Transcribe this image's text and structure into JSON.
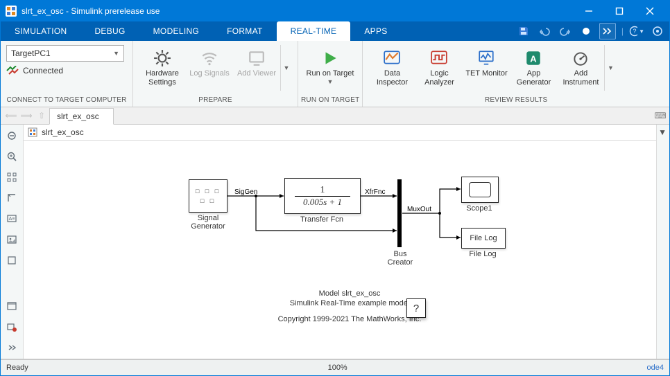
{
  "window": {
    "title": "slrt_ex_osc - Simulink prerelease use"
  },
  "tabs": {
    "items": [
      "SIMULATION",
      "DEBUG",
      "MODELING",
      "FORMAT",
      "REAL-TIME",
      "APPS"
    ],
    "active_index": 4
  },
  "toolstrip": {
    "connect": {
      "label": "CONNECT TO TARGET COMPUTER",
      "target_selected": "TargetPC1",
      "status": "Connected"
    },
    "prepare": {
      "label": "PREPARE",
      "hardware": "Hardware\nSettings",
      "log": "Log\nSignals",
      "viewer": "Add\nViewer"
    },
    "run": {
      "label": "RUN ON TARGET",
      "button": "Run on\nTarget"
    },
    "review": {
      "label": "REVIEW RESULTS",
      "di": "Data\nInspector",
      "la": "Logic\nAnalyzer",
      "tet": "TET\nMonitor",
      "appgen": "App\nGenerator",
      "addinstr": "Add\nInstrument"
    }
  },
  "model_tabs": {
    "name": "slrt_ex_osc"
  },
  "breadcrumb": {
    "name": "slrt_ex_osc"
  },
  "blocks": {
    "siggen": {
      "label": "Signal\nGenerator",
      "sig": "SigGen"
    },
    "tf": {
      "label": "Transfer Fcn",
      "num": "1",
      "den": "0.005s + 1",
      "sig": "XfrFnc"
    },
    "mux": {
      "label": "Bus\nCreator",
      "sig": "MuxOut"
    },
    "scope": {
      "label": "Scope1"
    },
    "filelog": {
      "label": "File Log",
      "text": "File Log"
    },
    "caption": {
      "l1": "Model slrt_ex_osc",
      "l2": "Simulink Real-Time example model",
      "l3": "Copyright 1999-2021 The MathWorks, Inc."
    },
    "help": "?"
  },
  "status": {
    "left": "Ready",
    "zoom": "100%",
    "solver": "ode4"
  }
}
